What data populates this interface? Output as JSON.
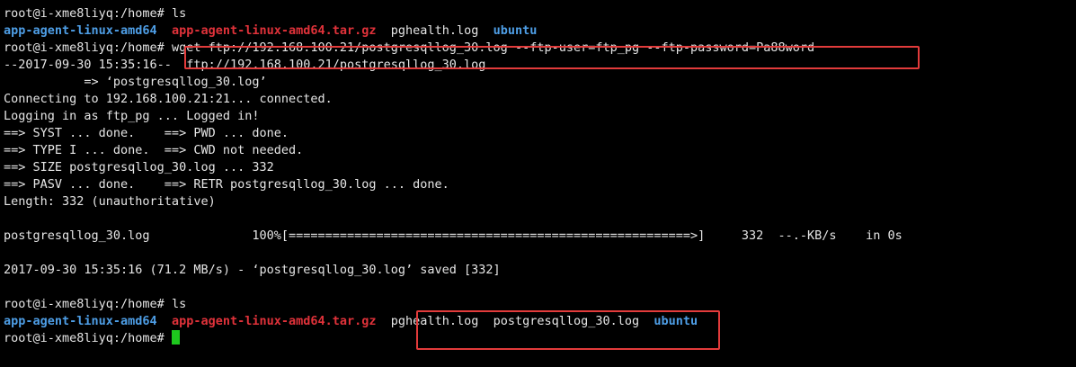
{
  "prompt": "root@i-xme8liyq:/home#",
  "commands": {
    "ls1": " ls",
    "wget": " wget ftp://192.168.100.21/postgresqllog_30.log --ftp-user=ftp_pg --ftp-password=Pa88word",
    "ls2": " ls"
  },
  "listing1": {
    "dir_app": "app-agent-linux-amd64",
    "tarball": "app-agent-linux-amd64.tar.gz",
    "file_pghealth": "pghealth.log",
    "dir_ubuntu": "ubuntu"
  },
  "wget_output": [
    "--2017-09-30 15:35:16--  ftp://192.168.100.21/postgresqllog_30.log",
    "           => ‘postgresqllog_30.log’",
    "Connecting to 192.168.100.21:21... connected.",
    "Logging in as ftp_pg ... Logged in!",
    "==> SYST ... done.    ==> PWD ... done.",
    "==> TYPE I ... done.  ==> CWD not needed.",
    "==> SIZE postgresqllog_30.log ... 332",
    "==> PASV ... done.    ==> RETR postgresqllog_30.log ... done.",
    "Length: 332 (unauthoritative)"
  ],
  "progress_line": "postgresqllog_30.log              100%[=======================================================>]     332  --.-KB/s    in 0s",
  "saved_line": "2017-09-30 15:35:16 (71.2 MB/s) - ‘postgresqllog_30.log’ saved [332]",
  "listing2": {
    "dir_app": "app-agent-linux-amd64",
    "tarball": "app-agent-linux-amd64.tar.gz",
    "files": "pghealth.log  postgresqllog_30.log",
    "dir_ubuntu": "ubuntu"
  },
  "colors": {
    "background": "#000000",
    "text": "#e6e6e6",
    "directory": "#4e9ee6",
    "archive": "#e0323a",
    "cursor": "#1ec81e",
    "highlight_box": "#e23b3b"
  }
}
